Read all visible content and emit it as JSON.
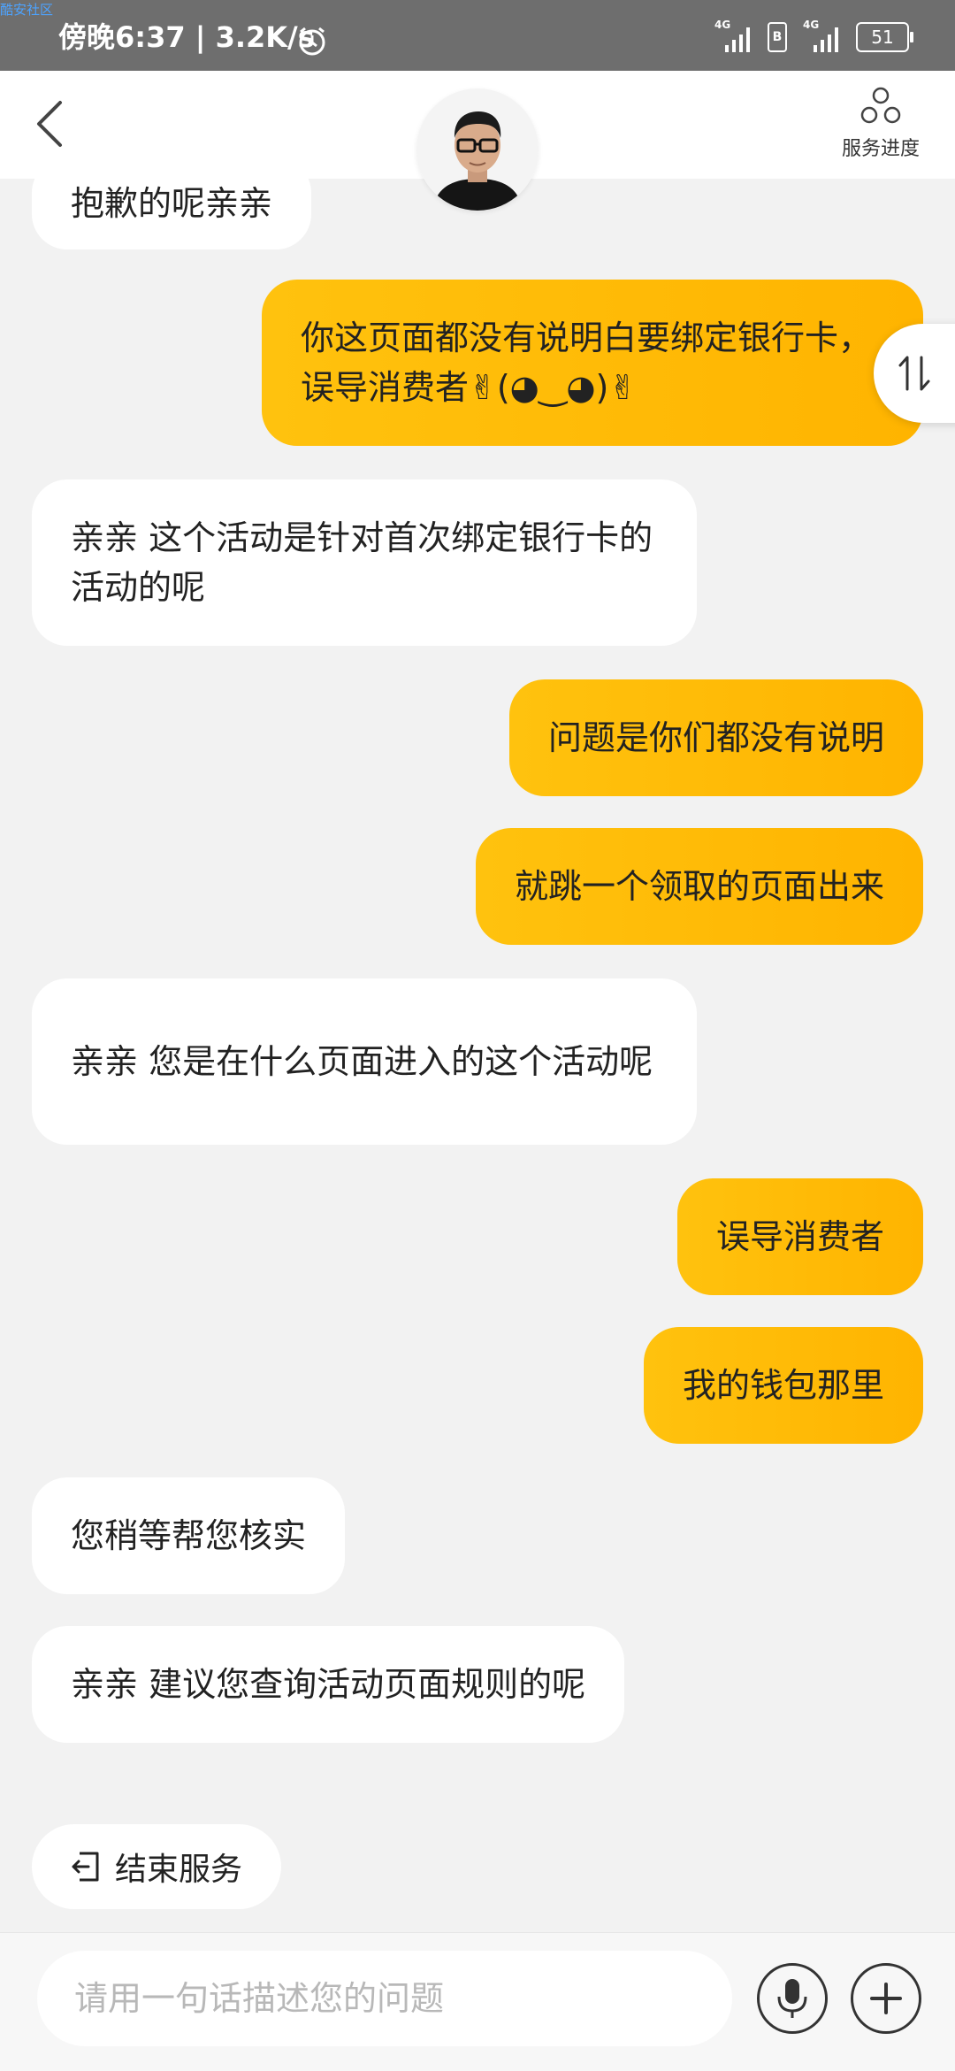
{
  "status_bar": {
    "watermark": "酷安社区",
    "time_speed": "傍晚6:37 | 3.2K/s",
    "signal_1_tag": "4G",
    "signal_2_tag": "4G",
    "hd_label": "B",
    "battery": "51"
  },
  "nav": {
    "progress_label": "服务进度"
  },
  "messages": [
    {
      "role": "agent",
      "text": "抱歉的呢亲亲"
    },
    {
      "role": "user",
      "text": "你这页面都没有说明白要绑定银行卡，误导消费者✌(◕‿◕)✌"
    },
    {
      "role": "agent",
      "text": "亲亲 这个活动是针对首次绑定银行卡的活动的呢"
    },
    {
      "role": "user",
      "text": "问题是你们都没有说明"
    },
    {
      "role": "user",
      "text": "就跳一个领取的页面出来"
    },
    {
      "role": "agent",
      "text": "亲亲 您是在什么页面进入的这个活动呢"
    },
    {
      "role": "user",
      "text": "误导消费者"
    },
    {
      "role": "user",
      "text": "我的钱包那里"
    },
    {
      "role": "agent",
      "text": "您稍等帮您核实"
    },
    {
      "role": "agent",
      "text": "亲亲 建议您查询活动页面规则的呢"
    }
  ],
  "end_service": {
    "label": "结束服务"
  },
  "input": {
    "placeholder": "请用一句话描述您的问题",
    "value": ""
  },
  "colors": {
    "user_bubble": "#ffbe00",
    "agent_bubble": "#ffffff",
    "background": "#f2f2f2",
    "status_bar": "#6e6e6e"
  }
}
